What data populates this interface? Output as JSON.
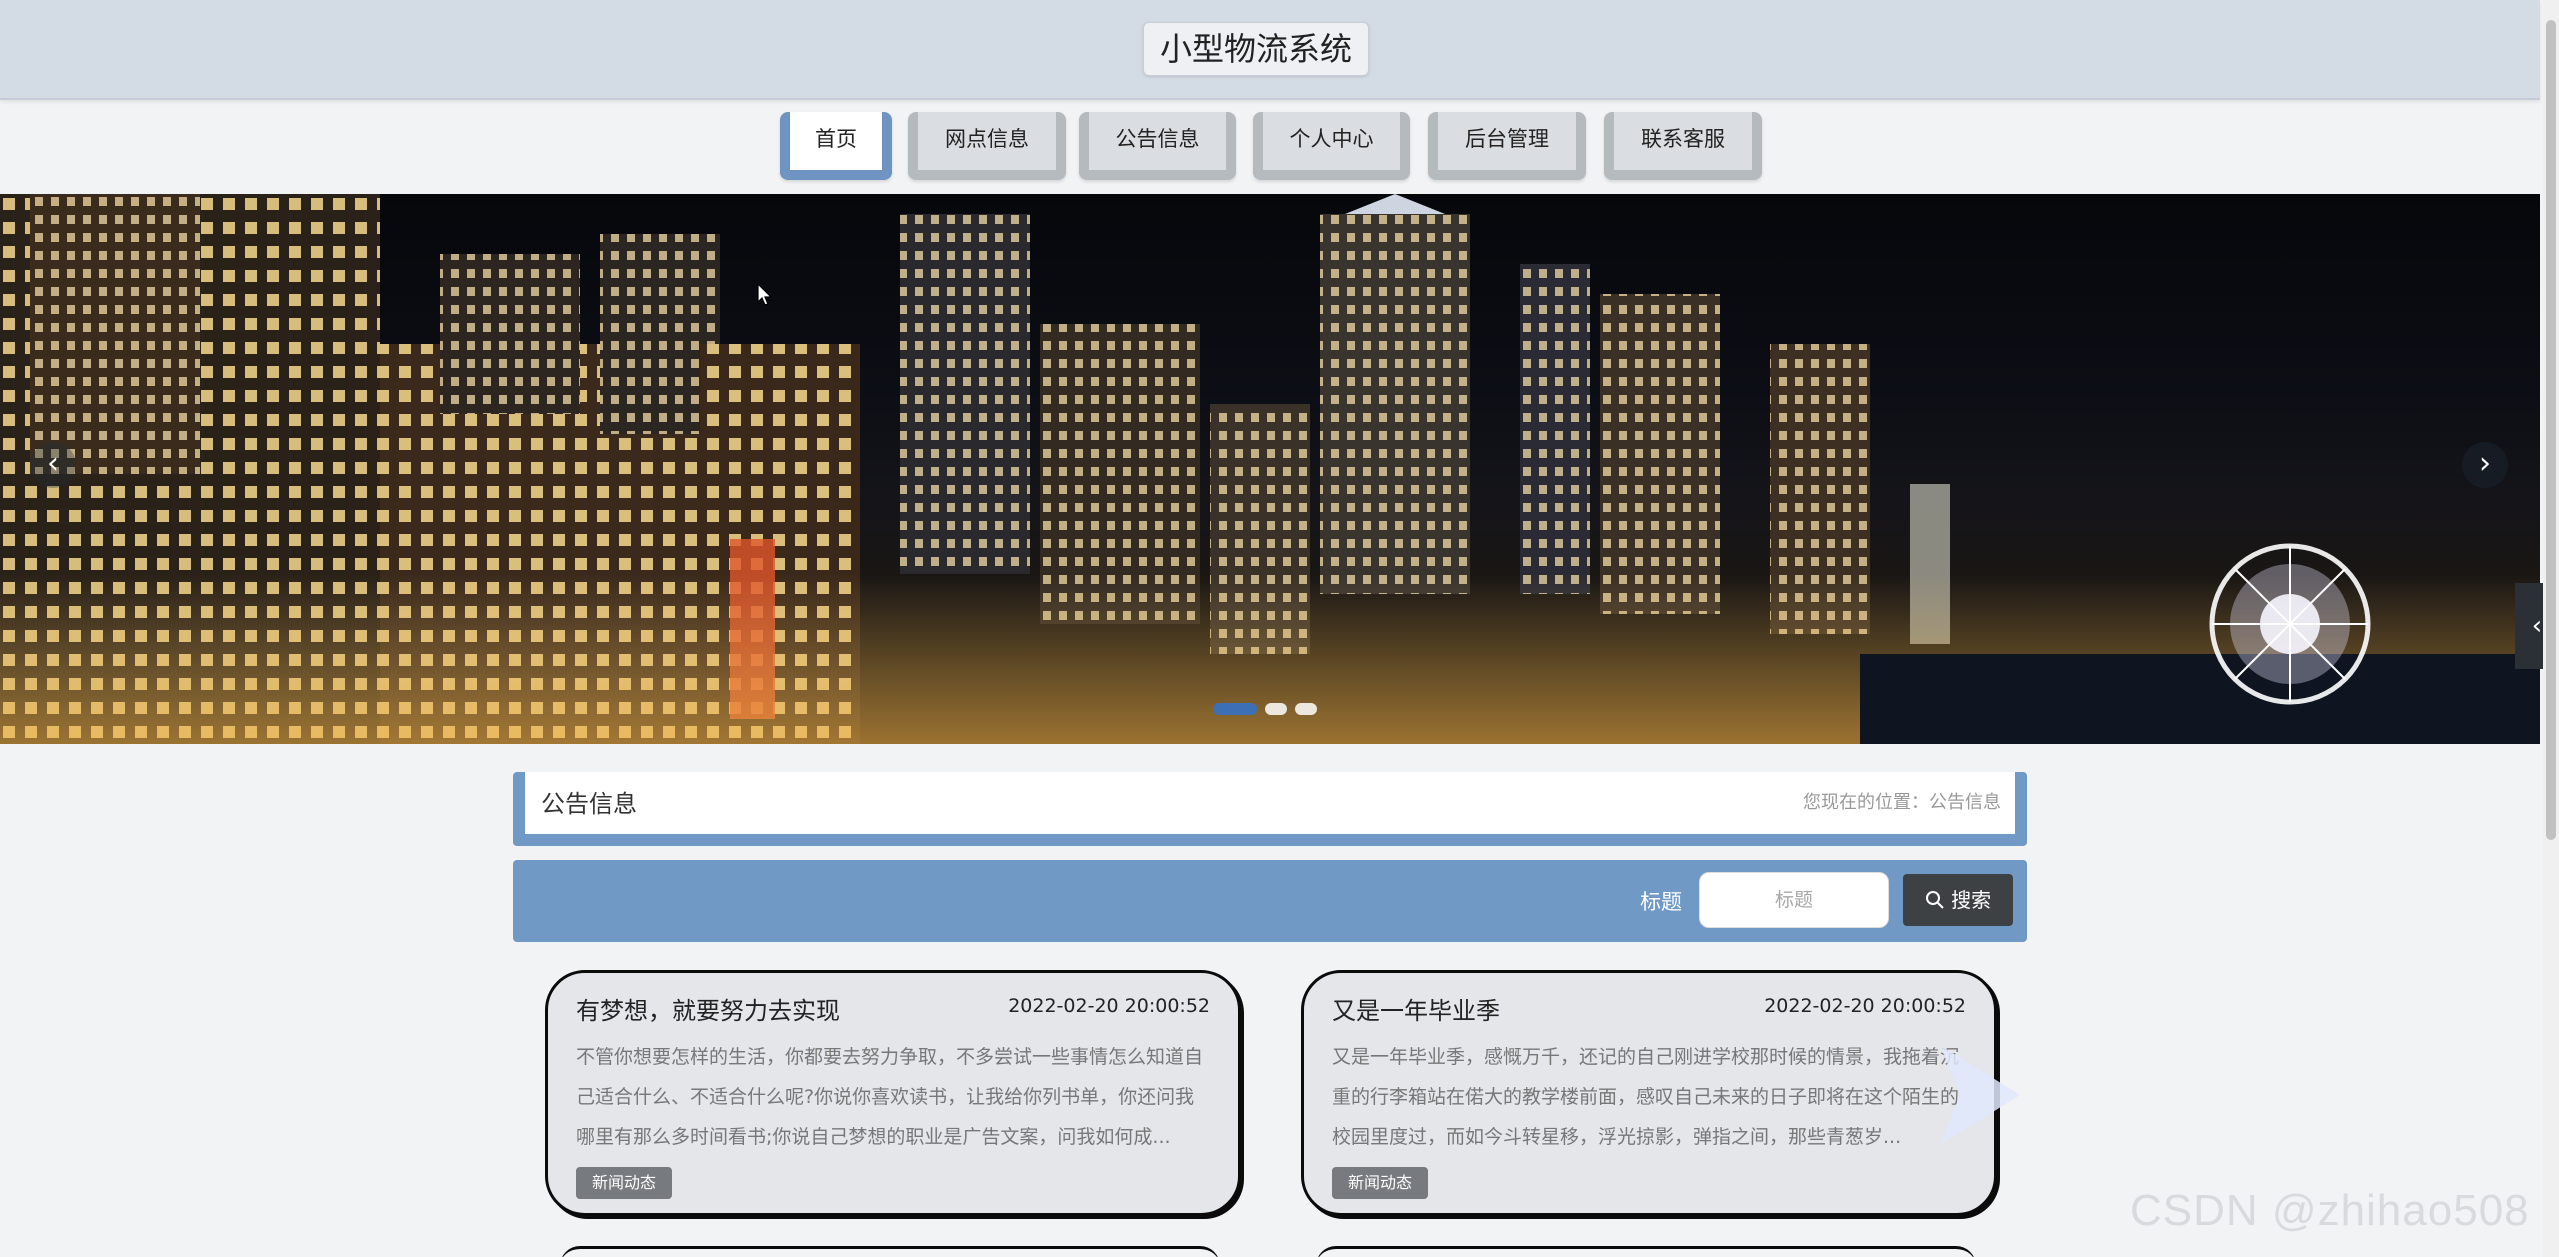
{
  "site": {
    "title": "小型物流系统"
  },
  "nav": {
    "items": [
      {
        "label": "首页",
        "active": true
      },
      {
        "label": "网点信息",
        "active": false
      },
      {
        "label": "公告信息",
        "active": false
      },
      {
        "label": "个人中心",
        "active": false
      },
      {
        "label": "后台管理",
        "active": false
      },
      {
        "label": "联系客服",
        "active": false
      }
    ]
  },
  "banner": {
    "prev_icon": "chevron-left-icon",
    "next_icon": "chevron-right-icon",
    "slide_count": 3,
    "active_slide": 1
  },
  "section": {
    "title": "公告信息",
    "breadcrumb": "您现在的位置：公告信息"
  },
  "search": {
    "label": "标题",
    "placeholder": "标题",
    "button_label": "搜索",
    "button_icon": "search-icon"
  },
  "cards": [
    {
      "title": "有梦想，就要努力去实现",
      "date": "2022-02-20 20:00:52",
      "body": "不管你想要怎样的生活，你都要去努力争取，不多尝试一些事情怎么知道自己适合什么、不适合什么呢?你说你喜欢读书，让我给你列书单，你还问我哪里有那么多时间看书;你说自己梦想的职业是广告文案，问我如何成...",
      "tag": "新闻动态"
    },
    {
      "title": "又是一年毕业季",
      "date": "2022-02-20 20:00:52",
      "body": "又是一年毕业季，感慨万千，还记的自己刚进学校那时候的情景，我拖着沉重的行李箱站在偌大的教学楼前面，感叹自己未来的日子即将在这个陌生的校园里度过，而如今斗转星移，浮光掠影，弹指之间，那些青葱岁...",
      "tag": "新闻动态"
    }
  ],
  "side_tab": {
    "icon": "chevron-left-icon"
  },
  "watermark": "CSDN @zhihao508",
  "colors": {
    "header_bg": "#d3dbe5",
    "accent": "#7099c6",
    "active_tab": "#6f94c2",
    "search_button": "#3e4144"
  }
}
